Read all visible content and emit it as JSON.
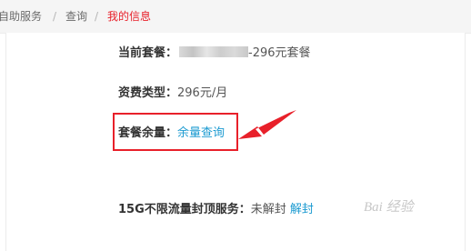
{
  "breadcrumb": {
    "items": [
      "自助服务",
      "查询",
      "我的信息"
    ],
    "separator": "/",
    "current_color": "#e8202a"
  },
  "info": {
    "plan": {
      "label": "当前套餐：",
      "value": "-296元套餐"
    },
    "fee_type": {
      "label": "资费类型：",
      "value": "296元/月"
    },
    "plan_balance": {
      "label": "套餐余量：",
      "link": "余量查询"
    },
    "cap_service": {
      "label": "15G不限流量封顶服务：",
      "status": "未解封",
      "link": "解封"
    }
  },
  "colors": {
    "link": "#1d9bd1",
    "highlight": "#e8202a"
  },
  "watermark": "Bai 经验"
}
